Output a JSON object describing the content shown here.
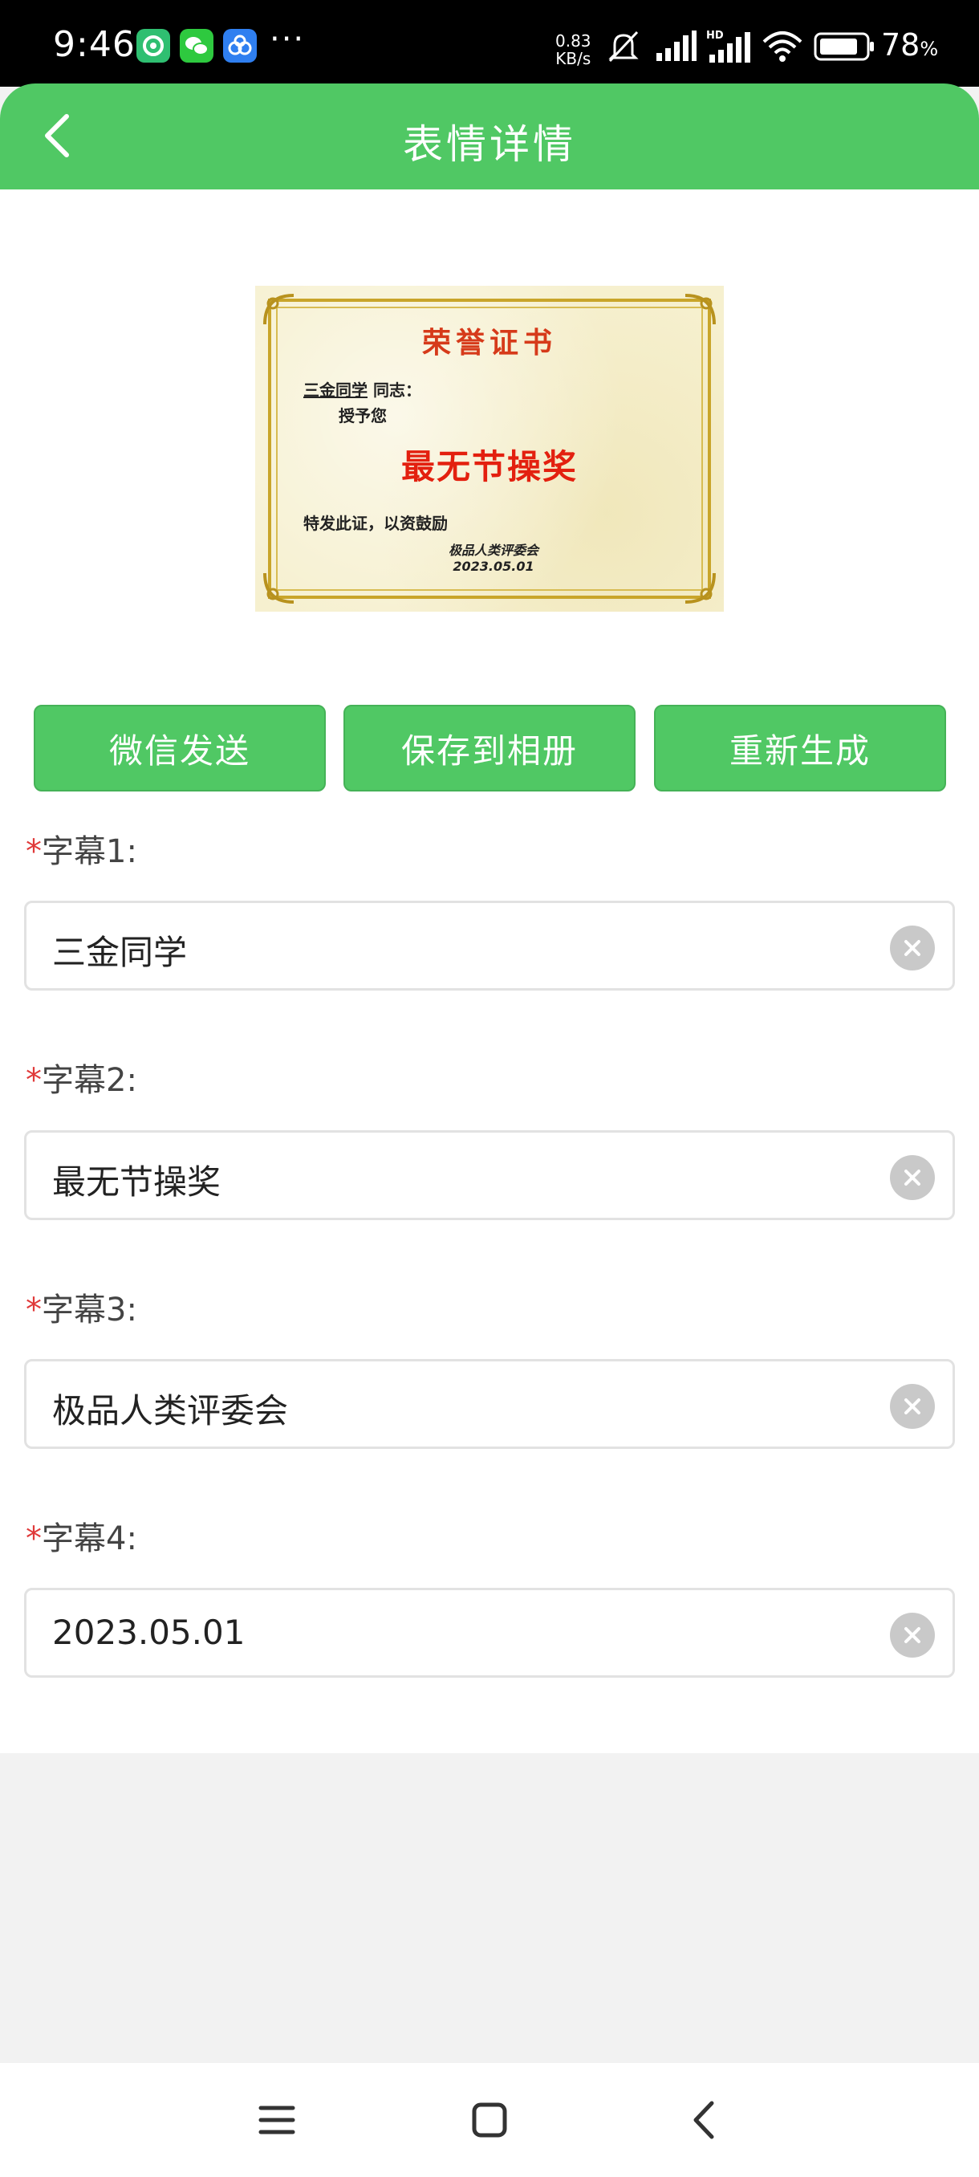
{
  "status_bar": {
    "time": "9:46",
    "net_speed_value": "0.83",
    "net_speed_unit": "KB/s",
    "battery_value": "78",
    "battery_unit": "%",
    "more": "···"
  },
  "header": {
    "title": "表情详情",
    "color": "#50c864"
  },
  "certificate": {
    "title": "荣誉证书",
    "name": "三金同学",
    "name_suffix": "同志：",
    "grant": "授予您",
    "award": "最无节操奖",
    "note": "特发此证，以资鼓励",
    "org": "极品人类评委会",
    "date": "2023.05.01"
  },
  "actions": {
    "wechat_send": "微信发送",
    "save_album": "保存到相册",
    "regenerate": "重新生成"
  },
  "fields": [
    {
      "required_mark": "*",
      "label": "字幕1:",
      "value": "三金同学"
    },
    {
      "required_mark": "*",
      "label": "字幕2:",
      "value": "最无节操奖"
    },
    {
      "required_mark": "*",
      "label": "字幕3:",
      "value": "极品人类评委会"
    },
    {
      "required_mark": "*",
      "label": "字幕4:",
      "value": "2023.05.01"
    }
  ]
}
